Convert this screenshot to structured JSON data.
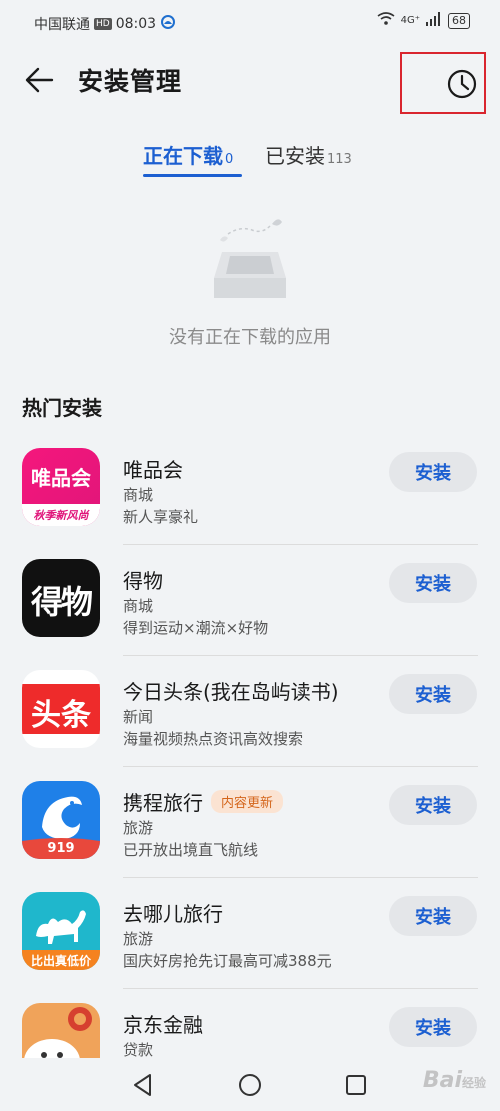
{
  "status_bar": {
    "carrier": "中国联通",
    "hd": "HD",
    "time": "08:03",
    "net": "4G⁺",
    "wifi_label": "6",
    "battery": "68"
  },
  "header": {
    "title": "安装管理"
  },
  "tabs": [
    {
      "label": "正在下载",
      "count": "0",
      "active": true
    },
    {
      "label": "已安装",
      "count": "113",
      "active": false
    }
  ],
  "empty_state": {
    "text": "没有正在下载的应用"
  },
  "section": {
    "title": "热门安装"
  },
  "install_label": "安装",
  "apps": [
    {
      "name": "唯品会",
      "category": "商城",
      "desc": "新人享豪礼",
      "icon_text": "唯品会",
      "icon_sub": "秋季新风尚",
      "icon_color": "#e8177a"
    },
    {
      "name": "得物",
      "category": "商城",
      "desc": "得到运动×潮流×好物",
      "icon_text": "得物",
      "icon_color": "#111111"
    },
    {
      "name": "今日头条(我在岛屿读书)",
      "category": "新闻",
      "desc": "海量视频热点资讯高效搜索",
      "icon_text": "头条",
      "icon_color": "#ee2b2b"
    },
    {
      "name": "携程旅行",
      "badge": "内容更新",
      "category": "旅游",
      "desc": "已开放出境直飞航线",
      "icon_text": "919",
      "icon_color": "#1f80e8"
    },
    {
      "name": "去哪儿旅行",
      "category": "旅游",
      "desc": "国庆好房抢先订最高可减388元",
      "icon_text": "比出真低价",
      "icon_color": "#1fb7cc"
    },
    {
      "name": "京东金融",
      "category": "贷款",
      "desc": "",
      "icon_color": "#f0a35a"
    }
  ],
  "watermark": {
    "text": "Bai",
    "sub": "经验"
  }
}
